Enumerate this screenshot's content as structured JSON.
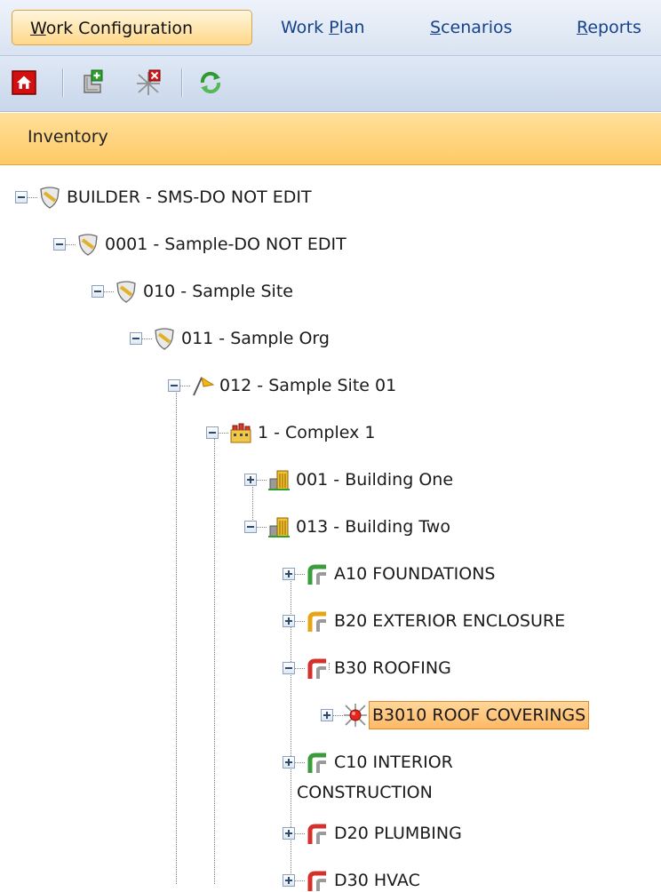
{
  "menu": {
    "tabs": [
      {
        "pre": "",
        "mn": "W",
        "post": "ork Configuration",
        "active": true
      },
      {
        "pre": "Work ",
        "mn": "P",
        "post": "lan",
        "active": false
      },
      {
        "pre": "",
        "mn": "S",
        "post": "cenarios",
        "active": false
      },
      {
        "pre": "",
        "mn": "R",
        "post": "eports",
        "active": false
      }
    ]
  },
  "toolbar": {
    "buttons": [
      "home-icon",
      "add-item-icon",
      "delete-item-icon",
      "refresh-icon"
    ]
  },
  "panel": {
    "title": "Inventory"
  },
  "tree": {
    "nodes": [
      {
        "label": "BUILDER - SMS-DO NOT EDIT",
        "icon": "shield-icon",
        "expanded": true
      },
      {
        "label": "0001 - Sample-DO NOT EDIT",
        "icon": "shield-icon",
        "expanded": true
      },
      {
        "label": "010 - Sample Site",
        "icon": "shield-icon",
        "expanded": true
      },
      {
        "label": "011 - Sample Org",
        "icon": "shield-icon",
        "expanded": true
      },
      {
        "label": "012 - Sample Site 01",
        "icon": "flag-icon",
        "expanded": true
      },
      {
        "label": "1 - Complex 1",
        "icon": "complex-icon",
        "expanded": true
      },
      {
        "label": "001 - Building One",
        "icon": "building-icon",
        "expanded": false
      },
      {
        "label": "013 - Building Two",
        "icon": "building-icon",
        "expanded": true
      },
      {
        "label": "A10 FOUNDATIONS",
        "icon": "system-pipe-green-icon",
        "expanded": false
      },
      {
        "label": "B20 EXTERIOR ENCLOSURE",
        "icon": "system-pipe-yellow-icon",
        "expanded": false
      },
      {
        "label": "B30 ROOFING",
        "icon": "system-pipe-red-icon",
        "expanded": true
      },
      {
        "label": "B3010 ROOF COVERINGS",
        "icon": "component-red-icon",
        "expanded": false,
        "selected": true
      },
      {
        "label_line1": "C10 INTERIOR",
        "label_line2": "CONSTRUCTION",
        "icon": "system-pipe-green-icon",
        "expanded": false
      },
      {
        "label": "D20 PLUMBING",
        "icon": "system-pipe-red-icon",
        "expanded": false
      },
      {
        "label": "D30 HVAC",
        "icon": "system-pipe-red-icon",
        "expanded": false
      }
    ]
  }
}
